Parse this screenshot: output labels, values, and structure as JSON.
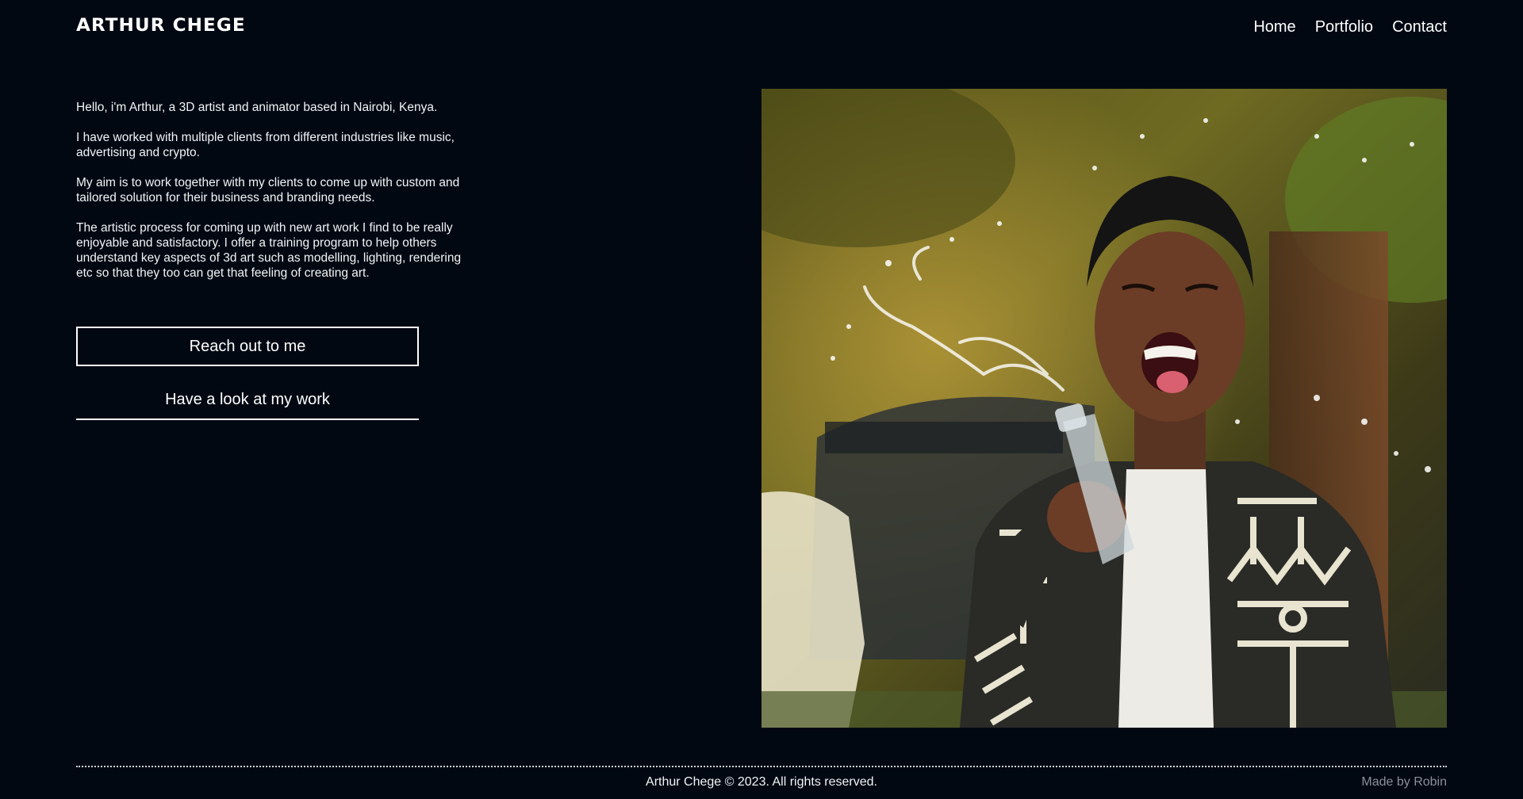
{
  "header": {
    "logo": "ARTHUR CHEGE",
    "nav": [
      {
        "label": "Home"
      },
      {
        "label": "Portfolio"
      },
      {
        "label": "Contact"
      }
    ]
  },
  "intro": {
    "paragraphs": [
      "Hello, i'm Arthur, a 3D artist and animator based in Nairobi, Kenya.",
      "I have worked with multiple clients from different industries like music, advertising and crypto.",
      "My aim is to work together with my clients to come up with custom and tailored solution for their business and branding needs.",
      "The artistic process for coming up with new art work I find to be really enjoyable and satisfactory. I offer a training program to help others understand key aspects of 3d art such as modelling, lighting, rendering etc so that they too can get that feeling of creating art."
    ]
  },
  "actions": {
    "primary_label": "Reach out to me",
    "secondary_label": "Have a look at my work"
  },
  "footer": {
    "copyright": "Arthur Chege © 2023. All rights reserved.",
    "credit": "Made by Robin"
  },
  "colors": {
    "background": "#020812",
    "text": "#ffffff",
    "muted": "#8a9099"
  }
}
